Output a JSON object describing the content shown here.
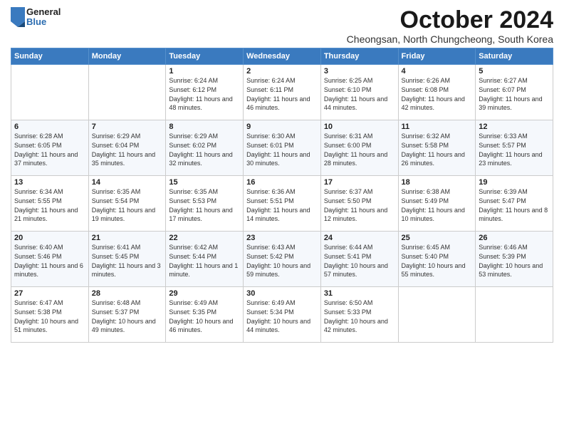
{
  "logo": {
    "general": "General",
    "blue": "Blue"
  },
  "header": {
    "month": "October 2024",
    "location": "Cheongsan, North Chungcheong, South Korea"
  },
  "days_of_week": [
    "Sunday",
    "Monday",
    "Tuesday",
    "Wednesday",
    "Thursday",
    "Friday",
    "Saturday"
  ],
  "weeks": [
    [
      {
        "day": "",
        "info": ""
      },
      {
        "day": "",
        "info": ""
      },
      {
        "day": "1",
        "info": "Sunrise: 6:24 AM\nSunset: 6:12 PM\nDaylight: 11 hours and 48 minutes."
      },
      {
        "day": "2",
        "info": "Sunrise: 6:24 AM\nSunset: 6:11 PM\nDaylight: 11 hours and 46 minutes."
      },
      {
        "day": "3",
        "info": "Sunrise: 6:25 AM\nSunset: 6:10 PM\nDaylight: 11 hours and 44 minutes."
      },
      {
        "day": "4",
        "info": "Sunrise: 6:26 AM\nSunset: 6:08 PM\nDaylight: 11 hours and 42 minutes."
      },
      {
        "day": "5",
        "info": "Sunrise: 6:27 AM\nSunset: 6:07 PM\nDaylight: 11 hours and 39 minutes."
      }
    ],
    [
      {
        "day": "6",
        "info": "Sunrise: 6:28 AM\nSunset: 6:05 PM\nDaylight: 11 hours and 37 minutes."
      },
      {
        "day": "7",
        "info": "Sunrise: 6:29 AM\nSunset: 6:04 PM\nDaylight: 11 hours and 35 minutes."
      },
      {
        "day": "8",
        "info": "Sunrise: 6:29 AM\nSunset: 6:02 PM\nDaylight: 11 hours and 32 minutes."
      },
      {
        "day": "9",
        "info": "Sunrise: 6:30 AM\nSunset: 6:01 PM\nDaylight: 11 hours and 30 minutes."
      },
      {
        "day": "10",
        "info": "Sunrise: 6:31 AM\nSunset: 6:00 PM\nDaylight: 11 hours and 28 minutes."
      },
      {
        "day": "11",
        "info": "Sunrise: 6:32 AM\nSunset: 5:58 PM\nDaylight: 11 hours and 26 minutes."
      },
      {
        "day": "12",
        "info": "Sunrise: 6:33 AM\nSunset: 5:57 PM\nDaylight: 11 hours and 23 minutes."
      }
    ],
    [
      {
        "day": "13",
        "info": "Sunrise: 6:34 AM\nSunset: 5:55 PM\nDaylight: 11 hours and 21 minutes."
      },
      {
        "day": "14",
        "info": "Sunrise: 6:35 AM\nSunset: 5:54 PM\nDaylight: 11 hours and 19 minutes."
      },
      {
        "day": "15",
        "info": "Sunrise: 6:35 AM\nSunset: 5:53 PM\nDaylight: 11 hours and 17 minutes."
      },
      {
        "day": "16",
        "info": "Sunrise: 6:36 AM\nSunset: 5:51 PM\nDaylight: 11 hours and 14 minutes."
      },
      {
        "day": "17",
        "info": "Sunrise: 6:37 AM\nSunset: 5:50 PM\nDaylight: 11 hours and 12 minutes."
      },
      {
        "day": "18",
        "info": "Sunrise: 6:38 AM\nSunset: 5:49 PM\nDaylight: 11 hours and 10 minutes."
      },
      {
        "day": "19",
        "info": "Sunrise: 6:39 AM\nSunset: 5:47 PM\nDaylight: 11 hours and 8 minutes."
      }
    ],
    [
      {
        "day": "20",
        "info": "Sunrise: 6:40 AM\nSunset: 5:46 PM\nDaylight: 11 hours and 6 minutes."
      },
      {
        "day": "21",
        "info": "Sunrise: 6:41 AM\nSunset: 5:45 PM\nDaylight: 11 hours and 3 minutes."
      },
      {
        "day": "22",
        "info": "Sunrise: 6:42 AM\nSunset: 5:44 PM\nDaylight: 11 hours and 1 minute."
      },
      {
        "day": "23",
        "info": "Sunrise: 6:43 AM\nSunset: 5:42 PM\nDaylight: 10 hours and 59 minutes."
      },
      {
        "day": "24",
        "info": "Sunrise: 6:44 AM\nSunset: 5:41 PM\nDaylight: 10 hours and 57 minutes."
      },
      {
        "day": "25",
        "info": "Sunrise: 6:45 AM\nSunset: 5:40 PM\nDaylight: 10 hours and 55 minutes."
      },
      {
        "day": "26",
        "info": "Sunrise: 6:46 AM\nSunset: 5:39 PM\nDaylight: 10 hours and 53 minutes."
      }
    ],
    [
      {
        "day": "27",
        "info": "Sunrise: 6:47 AM\nSunset: 5:38 PM\nDaylight: 10 hours and 51 minutes."
      },
      {
        "day": "28",
        "info": "Sunrise: 6:48 AM\nSunset: 5:37 PM\nDaylight: 10 hours and 49 minutes."
      },
      {
        "day": "29",
        "info": "Sunrise: 6:49 AM\nSunset: 5:35 PM\nDaylight: 10 hours and 46 minutes."
      },
      {
        "day": "30",
        "info": "Sunrise: 6:49 AM\nSunset: 5:34 PM\nDaylight: 10 hours and 44 minutes."
      },
      {
        "day": "31",
        "info": "Sunrise: 6:50 AM\nSunset: 5:33 PM\nDaylight: 10 hours and 42 minutes."
      },
      {
        "day": "",
        "info": ""
      },
      {
        "day": "",
        "info": ""
      }
    ]
  ]
}
